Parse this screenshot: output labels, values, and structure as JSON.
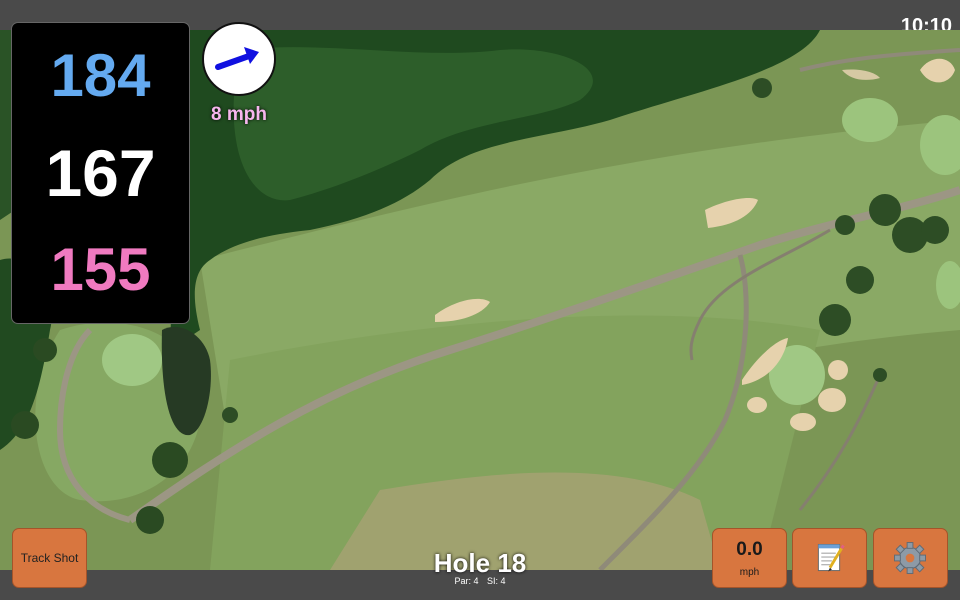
{
  "status_bar": {
    "time": "10:10"
  },
  "distances": {
    "back": "184",
    "middle": "167",
    "front": "155"
  },
  "wind": {
    "speed_label": "8 mph",
    "icon": "wind-direction-arrow-icon",
    "arrow_color": "#1010e0"
  },
  "track_shot": {
    "label": "Track Shot"
  },
  "hole": {
    "title": "Hole 18",
    "par": "Par: 4",
    "si": "SI: 4"
  },
  "speed_button": {
    "value": "0.0",
    "unit": "mph"
  },
  "notes_button": {
    "icon": "notepad-icon"
  },
  "settings_button": {
    "icon": "gear-icon"
  },
  "colors": {
    "back_distance": "#64aaf0",
    "middle_distance": "#ffffff",
    "front_distance": "#f07ac0",
    "button_bg": "#d8763f",
    "wind_label": "#f7b6ee"
  }
}
